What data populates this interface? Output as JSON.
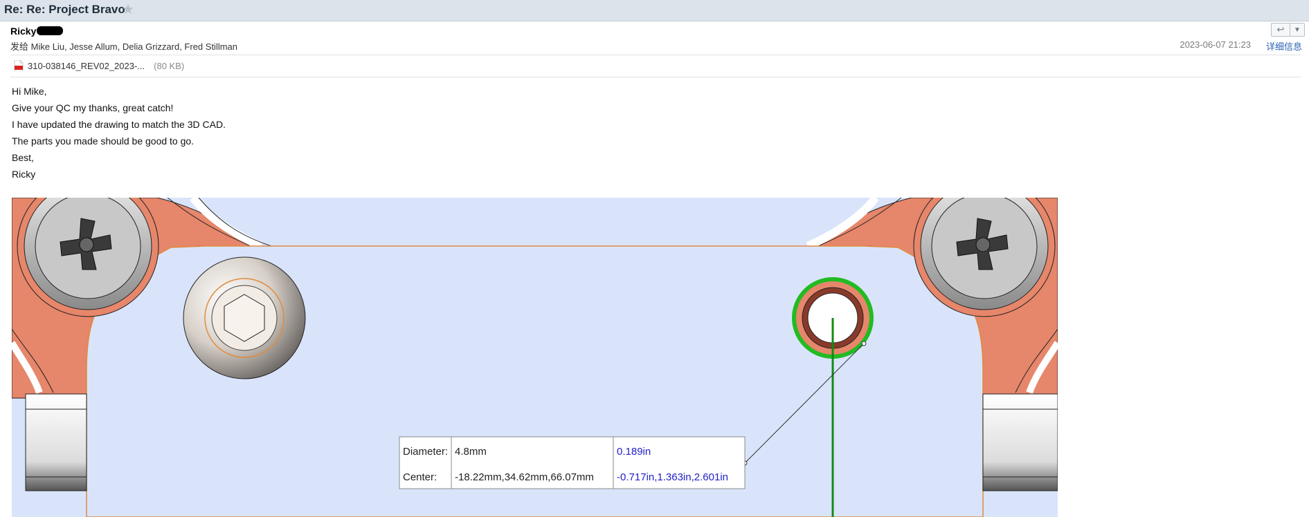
{
  "email": {
    "subject": "Re: Re: Project Bravo",
    "sender": "Ricky",
    "recipients_prefix": "发给",
    "recipients": "Mike Liu, Jesse Allum, Delia Grizzard, Fred Stillman",
    "datetime": "2023-06-07 21:23",
    "details_label": "详细信息",
    "attachment": {
      "name": "310-038146_REV02_2023-...",
      "size": "(80 KB)"
    },
    "body_lines": [
      "Hi Mike,",
      "Give your QC my thanks, great catch!",
      "I have updated the drawing to match the 3D CAD.",
      "The parts you made should be good to go.",
      "Best,",
      "Ricky"
    ]
  },
  "icons": {
    "star": "star-icon",
    "reply": "reply-icon",
    "more": "chevron-down-icon",
    "attachment": "pdf-file-icon"
  },
  "measurement": {
    "diameter_label": "Diameter:",
    "diameter_mm": "4.8mm",
    "diameter_in": "0.189in",
    "center_label": "Center:",
    "center_mm": "-18.22mm,34.62mm,66.07mm",
    "center_in": "-0.717in,1.363in,2.601in"
  },
  "colors": {
    "title_bar": "#dce3ea",
    "link": "#2c62b4",
    "cad_background": "#d9e4fb",
    "cad_copper": "#e6866a",
    "selection_green": "#22bb22",
    "imperial_value": "#2020c8"
  }
}
